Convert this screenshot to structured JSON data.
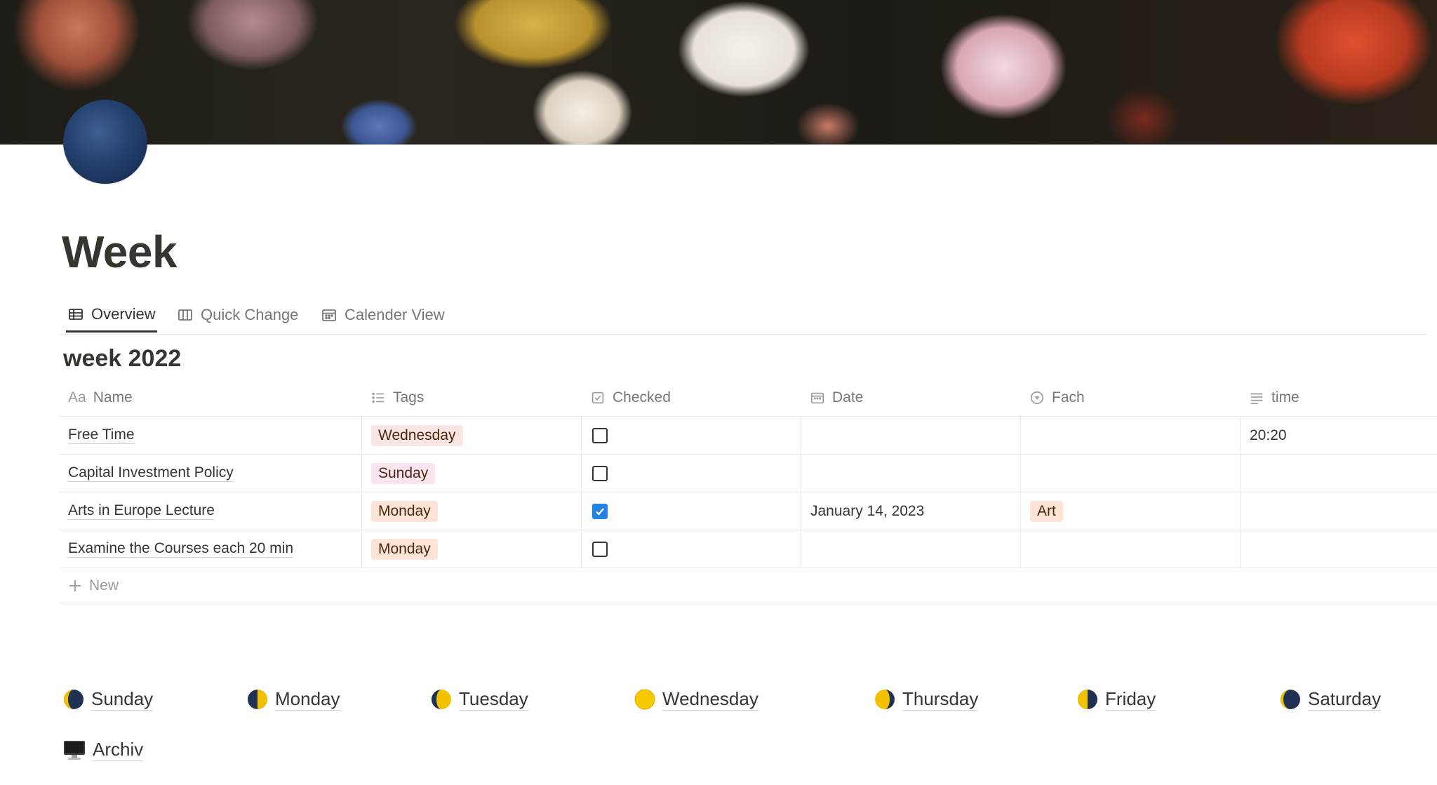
{
  "page": {
    "title": "Week",
    "icon": "full-moon-icon"
  },
  "tabs": [
    {
      "label": "Overview",
      "icon": "table-icon",
      "active": true
    },
    {
      "label": "Quick Change",
      "icon": "board-icon",
      "active": false
    },
    {
      "label": "Calender View",
      "icon": "calendar-icon",
      "active": false
    }
  ],
  "database": {
    "title": "week 2022",
    "columns": [
      {
        "label": "Name",
        "icon": "text-aa-icon"
      },
      {
        "label": "Tags",
        "icon": "multi-select-icon"
      },
      {
        "label": "Checked",
        "icon": "checkbox-icon"
      },
      {
        "label": "Date",
        "icon": "calendar-icon"
      },
      {
        "label": "Fach",
        "icon": "select-icon"
      },
      {
        "label": "time",
        "icon": "text-lines-icon"
      }
    ],
    "rows": [
      {
        "name": "Free Time",
        "tag": "Wednesday",
        "tag_color": "#fbe4e4",
        "checked": false,
        "date": "",
        "fach": "",
        "time": "20:20"
      },
      {
        "name": "Capital Investment Policy",
        "tag": "Sunday",
        "tag_color": "#fce4f1",
        "checked": false,
        "date": "",
        "fach": "",
        "time": ""
      },
      {
        "name": "Arts in Europe Lecture",
        "tag": "Monday",
        "tag_color": "#fde4d6",
        "checked": true,
        "date": "January 14, 2023",
        "fach": "Art",
        "time": ""
      },
      {
        "name": "Examine the Courses each 20 min",
        "tag": "Monday",
        "tag_color": "#fde4d6",
        "checked": false,
        "date": "",
        "fach": "",
        "time": ""
      }
    ],
    "fach_color": "#fde4d6",
    "new_label": "New"
  },
  "days": [
    {
      "label": "Sunday",
      "icon": "new-moon-icon"
    },
    {
      "label": "Monday",
      "icon": "first-quarter-moon-icon"
    },
    {
      "label": "Tuesday",
      "icon": "waxing-gibbous-moon-icon"
    },
    {
      "label": "Wednesday",
      "icon": "full-moon-icon"
    },
    {
      "label": "Thursday",
      "icon": "waning-gibbous-moon-icon"
    },
    {
      "label": "Friday",
      "icon": "last-quarter-moon-icon"
    },
    {
      "label": "Saturday",
      "icon": "waning-crescent-moon-icon"
    }
  ],
  "archiv": {
    "label": "Archiv",
    "icon": "desktop-computer-icon"
  },
  "colors": {
    "text": "#37352f",
    "muted": "#787774",
    "accent": "#2383e2",
    "divider": "#e9e9e7"
  }
}
